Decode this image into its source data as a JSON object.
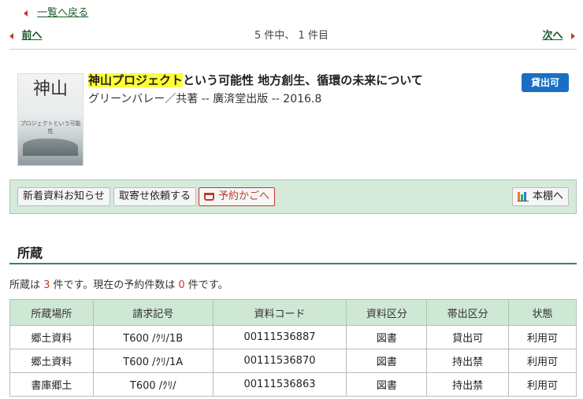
{
  "nav": {
    "back_label": "一覧へ戻る",
    "prev_label": "前へ",
    "next_label": "次へ",
    "count_text": "5 件中、 1 件目"
  },
  "book": {
    "title_highlight": "神山プロジェクト",
    "title_rest": "という可能性 地方創生、循環の未来について",
    "meta": "グリーンバレー／共著 -- 廣済堂出版 -- 2016.8",
    "badge": "貸出可",
    "cover_title": "神山",
    "cover_sub": "プロジェクトという可能性"
  },
  "toolbar": {
    "new_notice_label": "新着資料お知らせ",
    "order_label": "取寄せ依頼する",
    "cart_label": "予約かごへ",
    "shelf_label": "本棚へ"
  },
  "holdings": {
    "heading": "所蔵",
    "summary_pre": "所蔵は ",
    "count": "3",
    "summary_mid": " 件です。現在の予約件数は ",
    "reserve_count": "0",
    "summary_post": " 件です。",
    "columns": [
      "所蔵場所",
      "請求記号",
      "資料コード",
      "資料区分",
      "帯出区分",
      "状態"
    ],
    "rows": [
      [
        "郷土資料",
        "T600 /ｸﾘ/1B",
        "00111536887",
        "図書",
        "貸出可",
        "利用可"
      ],
      [
        "郷土資料",
        "T600 /ｸﾘ/1A",
        "00111536870",
        "図書",
        "持出禁",
        "利用可"
      ],
      [
        "書庫郷土",
        "T600 /ｸﾘ/",
        "00111536863",
        "図書",
        "持出禁",
        "利用可"
      ]
    ]
  },
  "colors": {
    "accent_green": "#2e8b57",
    "badge_blue": "#1a6fc4",
    "highlight": "#ffff33",
    "count_red": "#c0392b"
  }
}
